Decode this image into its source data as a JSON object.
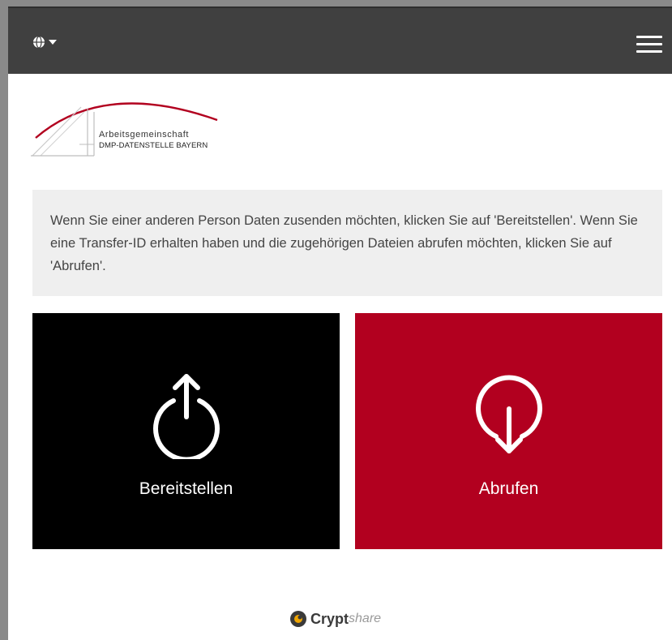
{
  "header": {
    "language_icon": "globe-icon",
    "language_caret_icon": "caret-down-icon",
    "menu_icon": "hamburger-menu-icon"
  },
  "logo": {
    "line1": "Arbeitsgemeinschaft",
    "line2": "DMP-DATENSTELLE BAYERN"
  },
  "info": {
    "text": "Wenn Sie einer anderen Person Daten zusenden möchten, klicken Sie auf 'Bereitstellen'. Wenn Sie eine Transfer-ID erhalten haben und die zugehörigen Dateien abrufen möchten, klicken Sie auf 'Abrufen'."
  },
  "actions": {
    "upload": {
      "label": "Bereitstellen",
      "icon": "upload-icon",
      "color": "#000000"
    },
    "download": {
      "label": "Abrufen",
      "icon": "download-icon",
      "color": "#b2001f"
    }
  },
  "footer": {
    "brand_bold": "Crypt",
    "brand_light": "share",
    "icon": "cryptshare-logo-icon"
  }
}
